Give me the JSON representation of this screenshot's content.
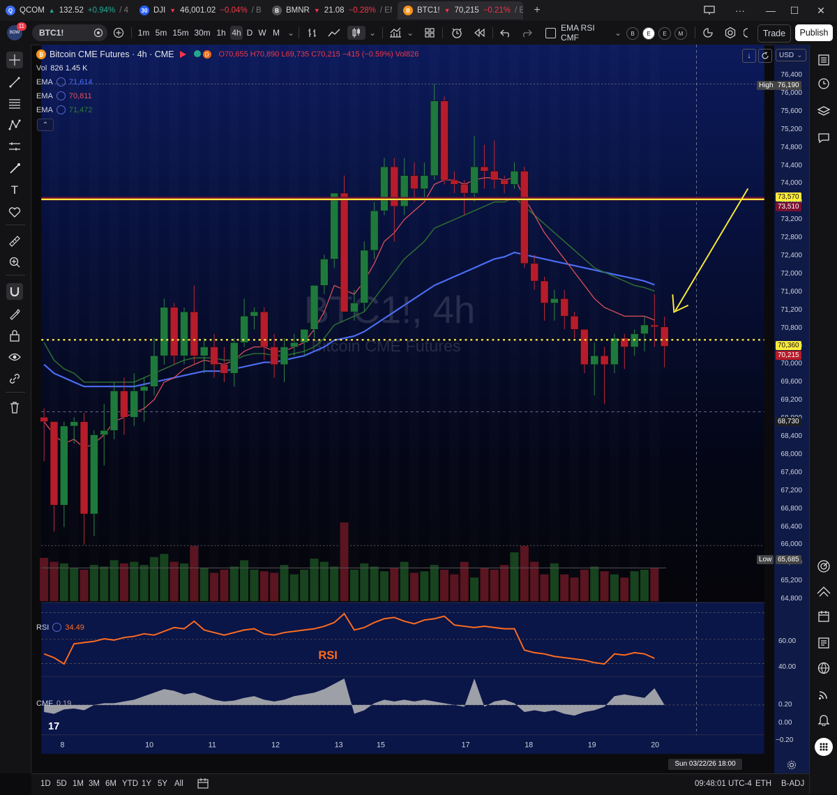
{
  "tabs": [
    {
      "symbol": "QCOM",
      "icon": "Q",
      "icon_color": "#3d6df2",
      "direction": "up",
      "price": "132.52",
      "change": "+0.94%",
      "tail": "/ 4"
    },
    {
      "symbol": "DJI",
      "icon": "30",
      "icon_color": "#2962ff",
      "direction": "down",
      "price": "46,001.02",
      "change": "−0.04%",
      "tail": "/ Bl"
    },
    {
      "symbol": "BMNR",
      "icon": "B",
      "icon_color": "#555",
      "direction": "down",
      "price": "21.08",
      "change": "−0.28%",
      "tail": "/ EMA"
    },
    {
      "symbol": "BTC1!",
      "icon": "B",
      "icon_color": "#f7931a",
      "direction": "down",
      "price": "70,215",
      "change": "−0.21%",
      "tail": "/ El"
    }
  ],
  "toolbar": {
    "avatar_label": "BOW",
    "notification_count": "11",
    "symbol": "BTC1!",
    "intervals": [
      "1m",
      "5m",
      "15m",
      "30m",
      "1h",
      "4h",
      "D",
      "W",
      "M"
    ],
    "selected_interval": "4h",
    "indicator_template": "EMA RSI CMF",
    "event_buttons": [
      "B",
      "E",
      "E",
      "M"
    ],
    "trade_label": "Trade",
    "publish_label": "Publish"
  },
  "legend": {
    "title": "Bitcoin CME Futures · 4h · CME",
    "badge": "D",
    "ohlc": "O70,655 H70,890 L69,735 C70,215 −415 (−0.59%) Vol826",
    "vol_label": "Vol",
    "vol_values": "826  1.45 K",
    "ema": [
      {
        "label": "EMA",
        "value": "71,614",
        "color": "#4c6ef5"
      },
      {
        "label": "EMA",
        "value": "70,811",
        "color": "#e0525a"
      },
      {
        "label": "EMA",
        "value": "71,472",
        "color": "#2e7d32"
      }
    ]
  },
  "watermark": {
    "title": "BTC1!, 4h",
    "subtitle": "Bitcoin CME Futures"
  },
  "currency": "USD",
  "price_axis": {
    "ticks": [
      "76,400",
      "76,000",
      "75,600",
      "75,200",
      "74,800",
      "74,400",
      "74,000",
      "73,600",
      "73,200",
      "72,800",
      "72,400",
      "72,000",
      "71,600",
      "71,200",
      "70,800",
      "70,400",
      "70,000",
      "69,600",
      "69,200",
      "68,800",
      "68,400",
      "68,000",
      "67,600",
      "67,200",
      "66,800",
      "66,400",
      "66,000",
      "65,600",
      "65,200",
      "64,800"
    ],
    "high_label": "High",
    "high_value": "76,190",
    "low_label": "Low",
    "low_value": "65,685",
    "line_yellow": "73,570",
    "line_maroon": "73,510",
    "dotted_level": "70,360",
    "last_price": "70,215",
    "crosshair_price": "68,730"
  },
  "rsi": {
    "label": "RSI",
    "value": "34.49",
    "annotation": "RSI",
    "ticks": [
      "60.00",
      "40.00"
    ]
  },
  "cmf": {
    "label": "CMF",
    "value": "0.19",
    "ticks": [
      "0.20",
      "0.00",
      "−0.20"
    ]
  },
  "time_axis": {
    "labels": [
      {
        "t": "8",
        "x": 76
      },
      {
        "t": "10",
        "x": 201
      },
      {
        "t": "11",
        "x": 294
      },
      {
        "t": "12",
        "x": 387
      },
      {
        "t": "13",
        "x": 480
      },
      {
        "t": "15",
        "x": 542
      },
      {
        "t": "17",
        "x": 667
      },
      {
        "t": "18",
        "x": 760
      },
      {
        "t": "19",
        "x": 853
      },
      {
        "t": "20",
        "x": 946
      }
    ],
    "cursor_label": "Sun 03/22/26   18:00"
  },
  "bottom": {
    "ranges": [
      "1D",
      "5D",
      "1M",
      "3M",
      "6M",
      "YTD",
      "1Y",
      "5Y",
      "All"
    ],
    "clock": "09:48:01 UTC-4",
    "session": "ETH",
    "adjust": "B-ADJ"
  },
  "colors": {
    "up": "#1e7a3c",
    "down": "#b71c2a",
    "yellow": "#ffeb3b",
    "maroon": "#7a1030",
    "panel_bg": "#0f1a47",
    "rsi_line": "#ff6d1f"
  },
  "chart_data": {
    "type": "candlestick",
    "interval": "4h",
    "y_range": [
      64600,
      76600
    ],
    "candles": [
      [
        68600,
        68800,
        67600,
        68500
      ],
      [
        68500,
        68500,
        66000,
        66600
      ],
      [
        66600,
        68500,
        66100,
        68400
      ],
      [
        68400,
        68600,
        68000,
        68500
      ],
      [
        68500,
        68700,
        65700,
        66400
      ],
      [
        66400,
        68300,
        65900,
        68200
      ],
      [
        68200,
        68900,
        67500,
        68300
      ],
      [
        68300,
        69400,
        68100,
        69200
      ],
      [
        69200,
        69500,
        68200,
        68600
      ],
      [
        68600,
        69600,
        68400,
        69200
      ],
      [
        69200,
        69500,
        68500,
        69300
      ],
      [
        69300,
        70400,
        69100,
        70000
      ],
      [
        70000,
        71300,
        69800,
        71100
      ],
      [
        71100,
        71200,
        69800,
        70000
      ],
      [
        70000,
        71100,
        69800,
        71000
      ],
      [
        71000,
        71600,
        69800,
        70000
      ],
      [
        70000,
        70400,
        69600,
        70200
      ],
      [
        70200,
        70500,
        69500,
        69800
      ],
      [
        69800,
        70200,
        69400,
        69600
      ],
      [
        69600,
        70400,
        69300,
        70300
      ],
      [
        70300,
        71300,
        70200,
        70900
      ],
      [
        70900,
        71100,
        70600,
        71000
      ],
      [
        71000,
        71100,
        69900,
        70200
      ],
      [
        70200,
        70500,
        69500,
        69800
      ],
      [
        69800,
        70400,
        69400,
        70200
      ],
      [
        70200,
        70500,
        70000,
        70300
      ],
      [
        70300,
        70600,
        70000,
        70600
      ],
      [
        70600,
        71500,
        70400,
        71600
      ],
      [
        71600,
        72300,
        71400,
        72200
      ],
      [
        72200,
        73700,
        72000,
        73700
      ],
      [
        73700,
        74100,
        71200,
        71000
      ],
      [
        71000,
        71500,
        70800,
        71200
      ],
      [
        71200,
        72600,
        71000,
        72400
      ],
      [
        72400,
        73500,
        72200,
        73300
      ],
      [
        73300,
        74500,
        73200,
        74300
      ],
      [
        74300,
        74500,
        72600,
        73400
      ],
      [
        73400,
        74500,
        73200,
        74100
      ],
      [
        74100,
        74400,
        73500,
        73800
      ],
      [
        73800,
        74400,
        73600,
        74100
      ],
      [
        74100,
        76190,
        74000,
        75800
      ],
      [
        75800,
        75900,
        73900,
        74000
      ],
      [
        74000,
        74200,
        73700,
        73900
      ],
      [
        73900,
        74000,
        73200,
        73700
      ],
      [
        73700,
        75000,
        73500,
        74300
      ],
      [
        74300,
        74800,
        73800,
        74200
      ],
      [
        74200,
        74900,
        73800,
        74000
      ],
      [
        74000,
        74100,
        73700,
        73900
      ],
      [
        73900,
        74400,
        73800,
        74200
      ],
      [
        74200,
        74300,
        72000,
        72100
      ],
      [
        72100,
        72300,
        71500,
        71700
      ],
      [
        71700,
        71800,
        70800,
        71200
      ],
      [
        71200,
        71500,
        70800,
        71300
      ],
      [
        71300,
        71500,
        70600,
        70900
      ],
      [
        70900,
        71000,
        70400,
        70600
      ],
      [
        70600,
        70600,
        69600,
        69800
      ],
      [
        69800,
        70300,
        69100,
        70000
      ],
      [
        70000,
        70200,
        68900,
        69800
      ],
      [
        69800,
        70500,
        69600,
        70400
      ],
      [
        70400,
        70500,
        69700,
        70200
      ],
      [
        70200,
        70600,
        70000,
        70500
      ],
      [
        70500,
        70900,
        70100,
        70700
      ],
      [
        70700,
        71400,
        70200,
        70655
      ],
      [
        70655,
        70890,
        69735,
        70215
      ]
    ],
    "volume": [
      55,
      50,
      48,
      42,
      40,
      46,
      44,
      52,
      48,
      50,
      46,
      56,
      60,
      50,
      48,
      70,
      42,
      36,
      40,
      44,
      52,
      40,
      38,
      36,
      46,
      34,
      40,
      54,
      50,
      44,
      100,
      40,
      48,
      44,
      38,
      42,
      50,
      36,
      38,
      46,
      40,
      34,
      50,
      30,
      42,
      40,
      46,
      62,
      70,
      50,
      34,
      48,
      34,
      30,
      40,
      44,
      38,
      34,
      30,
      38,
      40,
      42
    ],
    "ema_fast": [
      68500,
      68200,
      68000,
      68100,
      67900,
      68000,
      68200,
      68500,
      68600,
      68700,
      68800,
      69000,
      69400,
      69500,
      69700,
      69800,
      69900,
      69850,
      69800,
      69900,
      70100,
      70200,
      70200,
      70100,
      70100,
      70200,
      70300,
      70600,
      71000,
      71600,
      71500,
      71400,
      71700,
      72100,
      72600,
      72800,
      73100,
      73300,
      73500,
      73900,
      74000,
      74000,
      73900,
      74000,
      74050,
      74050,
      74000,
      74050,
      73600,
      73200,
      72800,
      72500,
      72200,
      71900,
      71600,
      71300,
      71100,
      71000,
      70900,
      70900,
      70900,
      70811
    ],
    "ema_mid": [
      70300,
      69900,
      69700,
      69600,
      69400,
      69400,
      69400,
      69400,
      69400,
      69400,
      69500,
      69600,
      69700,
      69800,
      69900,
      69950,
      69950,
      69950,
      69900,
      69900,
      70000,
      70050,
      70050,
      70000,
      70000,
      70050,
      70100,
      70200,
      70400,
      70700,
      70800,
      70900,
      71000,
      71300,
      71600,
      71900,
      72200,
      72400,
      72600,
      72900,
      73000,
      73100,
      73200,
      73300,
      73400,
      73500,
      73500,
      73600,
      73400,
      73200,
      73000,
      72800,
      72600,
      72400,
      72200,
      72000,
      71900,
      71800,
      71700,
      71600,
      71550,
      71472
    ],
    "ema_slow": [
      69800,
      69600,
      69500,
      69400,
      69300,
      69300,
      69300,
      69300,
      69300,
      69300,
      69350,
      69400,
      69450,
      69500,
      69550,
      69600,
      69650,
      69650,
      69650,
      69700,
      69750,
      69800,
      69850,
      69850,
      69900,
      69950,
      70000,
      70100,
      70200,
      70350,
      70400,
      70450,
      70550,
      70700,
      70850,
      71000,
      71150,
      71300,
      71450,
      71600,
      71700,
      71800,
      71900,
      72000,
      72100,
      72200,
      72250,
      72350,
      72300,
      72250,
      72200,
      72150,
      72100,
      72050,
      72000,
      71950,
      71900,
      71850,
      71800,
      71750,
      71700,
      71614
    ],
    "rsi": [
      38,
      35,
      30,
      46,
      47,
      48,
      50,
      49,
      51,
      52,
      54,
      53,
      56,
      59,
      58,
      64,
      57,
      55,
      53,
      55,
      57,
      58,
      54,
      53,
      55,
      56,
      57,
      58,
      60,
      63,
      70,
      57,
      59,
      63,
      66,
      67,
      64,
      62,
      65,
      66,
      68,
      61,
      60,
      59,
      60,
      59,
      58,
      58,
      41,
      39,
      38,
      36,
      35,
      34,
      33,
      31,
      30,
      38,
      37,
      39,
      38,
      34.49
    ],
    "cmf": [
      -0.08,
      -0.1,
      -0.05,
      -0.04,
      -0.06,
      0.0,
      0.02,
      0.02,
      0.04,
      0.06,
      0.1,
      0.14,
      0.18,
      0.16,
      0.12,
      0.14,
      0.1,
      0.06,
      0.04,
      0.05,
      0.08,
      0.1,
      0.06,
      0.04,
      0.06,
      0.1,
      0.12,
      0.14,
      0.18,
      0.24,
      0.3,
      -0.1,
      -0.06,
      0.02,
      0.06,
      0.04,
      0.06,
      0.04,
      0.06,
      0.04,
      0.02,
      0.0,
      -0.02,
      0.3,
      -0.02,
      0.04,
      0.06,
      0.02,
      -0.08,
      -0.06,
      -0.08,
      -0.06,
      -0.1,
      -0.12,
      -0.08,
      -0.06,
      -0.02,
      0.1,
      0.12,
      0.1,
      0.08,
      0.19
    ]
  }
}
